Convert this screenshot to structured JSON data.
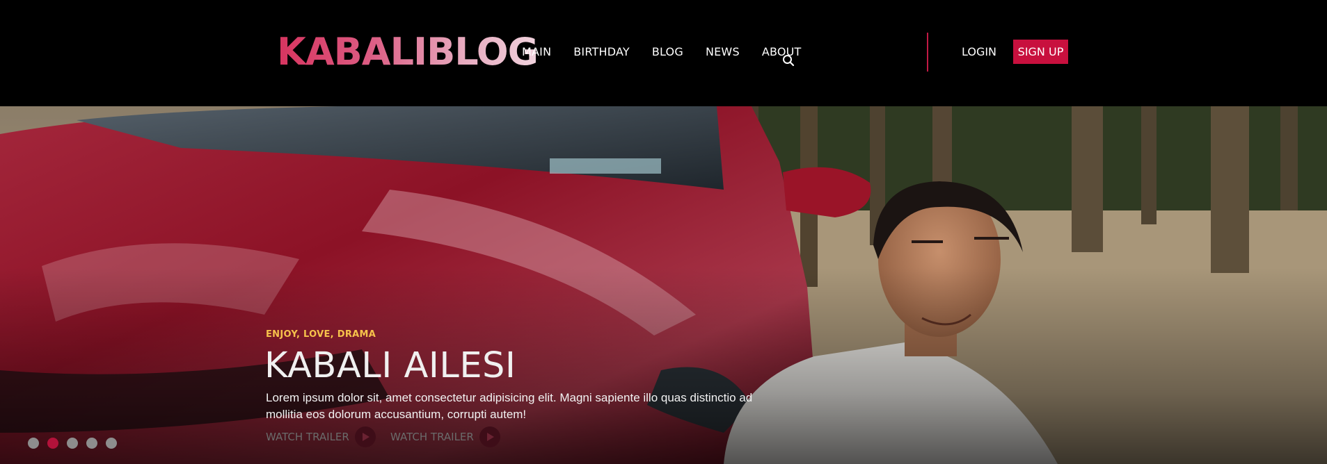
{
  "header": {
    "logo_part1": "KABALI",
    "logo_part2": "BLOG",
    "nav": [
      {
        "label": "MAIN"
      },
      {
        "label": "BIRTHDAY"
      },
      {
        "label": "BLOG"
      },
      {
        "label": "NEWS"
      },
      {
        "label": "ABOUT"
      }
    ],
    "login_label": "LOGIN",
    "signup_label": "SIGN UP",
    "accent_color": "#c8103e"
  },
  "hero": {
    "tagline": "ENJOY, LOVE, DRAMA",
    "title": "KABALI AILESI",
    "description": "Lorem ipsum dolor sit, amet consectetur adipisicing elit. Magni sapiente illo quas distinctio ad mollitia eos dolorum accusantium, corrupti autem!",
    "buttons": [
      {
        "label": "WATCH TRAILER",
        "icon": "play-icon"
      },
      {
        "label": "WATCH TRAILER",
        "icon": "play-icon"
      }
    ],
    "slides": 5,
    "active_slide": 2
  }
}
